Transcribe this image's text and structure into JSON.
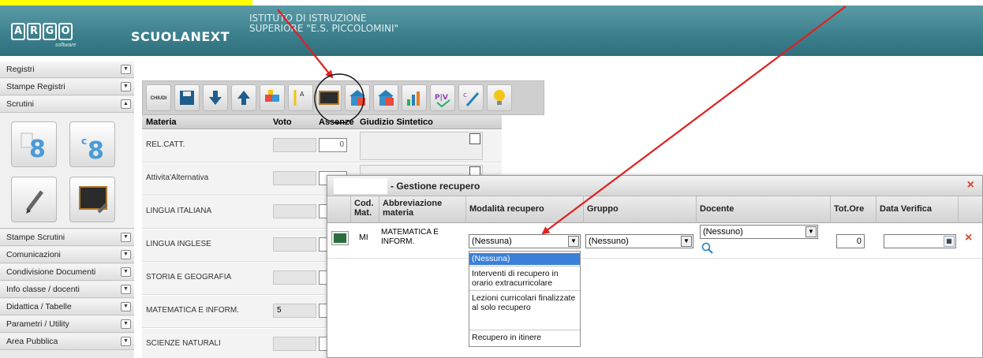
{
  "header": {
    "logo_text": "ARGO",
    "logo_sub": "software",
    "app_name": "SCUOLANEXT",
    "school": "ISTITUTO DI ISTRUZIONE SUPERIORE \"E.S. PICCOLOMINI\""
  },
  "sidebar": {
    "top_items": [
      "Registri",
      "Stampe Registri",
      "Scrutini"
    ],
    "bottom_items": [
      "Stampe Scrutini",
      "Comunicazioni",
      "Condivisione Documenti",
      "Info classe / docenti",
      "Didattica / Tabelle",
      "Parametri / Utility",
      "Area Pubblica"
    ],
    "big_btn_1": "8",
    "big_btn_2": "8"
  },
  "toolbar": {
    "close_label": "CHIUDI",
    "pv_label": "P|V"
  },
  "grid": {
    "columns": [
      "Materia",
      "Voto",
      "Assenze",
      "Giudizio Sintetico"
    ],
    "rows": [
      {
        "materia": "REL.CATT.",
        "voto": "",
        "assenze": "0"
      },
      {
        "materia": "Attivita'Alternativa",
        "voto": "",
        "assenze": ""
      },
      {
        "materia": "LINGUA ITALIANA",
        "voto": "",
        "assenze": ""
      },
      {
        "materia": "LINGUA INGLESE",
        "voto": "",
        "assenze": ""
      },
      {
        "materia": "STORIA E GEOGRAFIA",
        "voto": "",
        "assenze": ""
      },
      {
        "materia": "MATEMATICA E INFORM.",
        "voto": "5",
        "assenze": ""
      },
      {
        "materia": "SCIENZE NATURALI",
        "voto": "",
        "assenze": ""
      }
    ]
  },
  "dialog": {
    "title": "- Gestione recupero",
    "close": "×",
    "columns": {
      "cod": "Cod. Mat.",
      "abbr": "Abbreviazione materia",
      "modalita": "Modalità recupero",
      "gruppo": "Gruppo",
      "docente": "Docente",
      "tot_ore": "Tot.Ore",
      "data_verifica": "Data Verifica"
    },
    "row": {
      "cod": "MI",
      "abbr": "MATEMATICA E INFORM.",
      "modalita": "(Nessuna)",
      "gruppo": "(Nessuno)",
      "docente": "(Nessuno)",
      "tot_ore": "0",
      "delete": "×"
    },
    "dropdown_options": [
      "(Nessuna)",
      "Interventi di recupero in orario extracurricolare",
      "Lezioni curricolari finalizzate al solo recupero",
      "Recupero in itinere"
    ]
  },
  "colors": {
    "header": "#3c7f8c",
    "highlight": "#ffff00",
    "annotation_arrow": "#e02020",
    "dropdown_selected": "#3b80d8",
    "close_red": "#d9442a"
  }
}
